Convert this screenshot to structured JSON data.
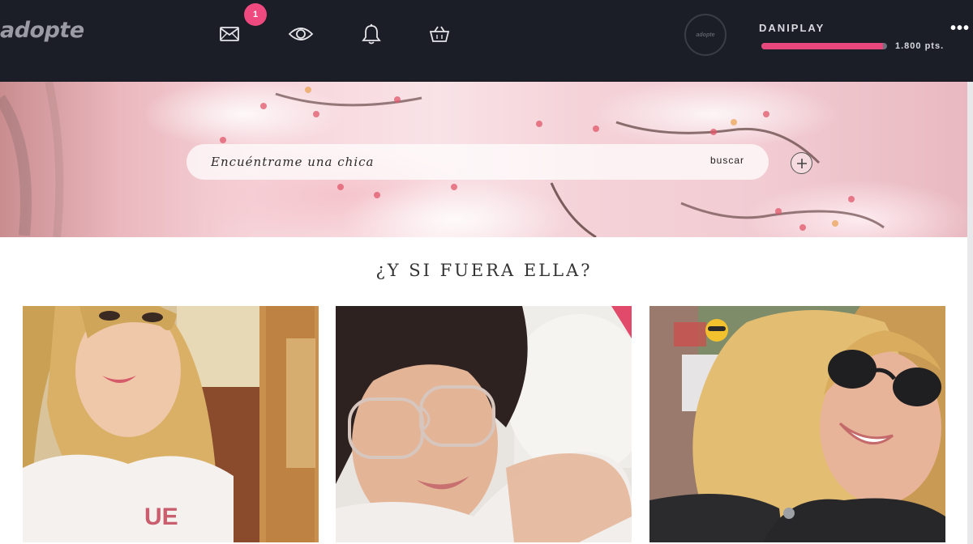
{
  "header": {
    "logo_text": "adopte",
    "icons": [
      "mail-icon",
      "eye-icon",
      "bell-icon",
      "basket-icon"
    ],
    "messages_badge": "1",
    "avatar_text": "adopte",
    "username": "DANIPLAY",
    "points_label": "1.800 pts.",
    "points_progress": 0.97,
    "more_menu": "•••"
  },
  "search": {
    "placeholder": "Encuéntrame una chica",
    "button_label": "buscar",
    "add_icon": "plus-circle-icon"
  },
  "section": {
    "title": "¿Y SI FUERA ELLA?"
  },
  "profiles": [
    {
      "photo": "profile-photo-1"
    },
    {
      "photo": "profile-photo-2"
    },
    {
      "photo": "profile-photo-3"
    }
  ],
  "colors": {
    "topbar": "#1b1e27",
    "accent_pink": "#ef4a7f",
    "text_light": "#d9dae0"
  }
}
